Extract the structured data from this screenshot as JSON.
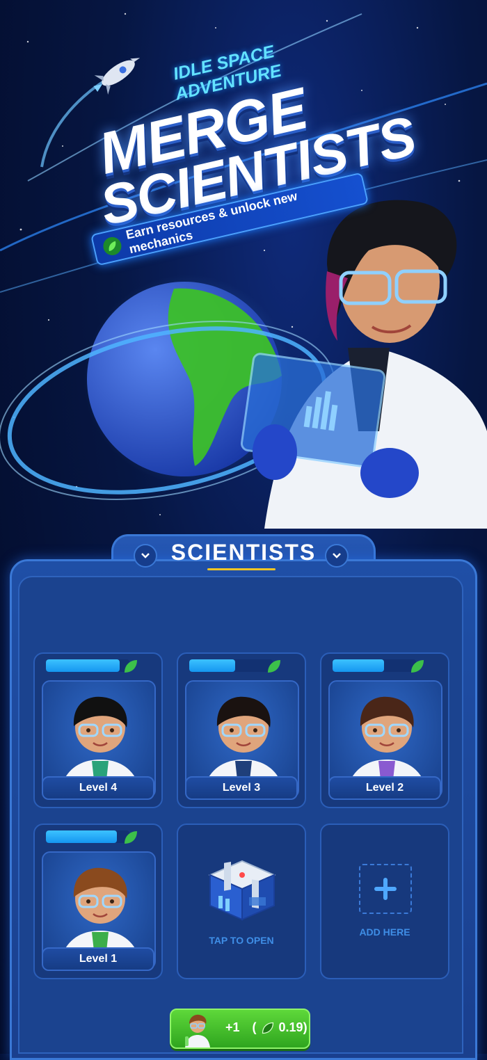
{
  "header": {
    "subtitle": "IDLE SPACE ADVENTURE",
    "title_line1": "MERGE",
    "title_line2": "SCIENTISTS",
    "tagline": "Earn resources & unlock new mechanics"
  },
  "panel": {
    "title": "SCIENTISTS",
    "slots": [
      {
        "type": "scientist",
        "level_label": "Level 4",
        "progress": 0.88,
        "hair": "#111111",
        "shirt": "#2aa37a"
      },
      {
        "type": "scientist",
        "level_label": "Level 3",
        "progress": 0.55,
        "hair": "#1a1210",
        "shirt": "#1f3f7a"
      },
      {
        "type": "scientist",
        "level_label": "Level 2",
        "progress": 0.62,
        "hair": "#4a2618",
        "shirt": "#8a5ad0"
      },
      {
        "type": "scientist",
        "level_label": "Level 1",
        "progress": 0.85,
        "hair": "#8a4a1e",
        "shirt": "#3cae4a"
      },
      {
        "type": "chest",
        "caption": "TAP TO OPEN"
      },
      {
        "type": "empty",
        "caption": "ADD HERE"
      }
    ]
  },
  "buy_button": {
    "amount": "+1",
    "open_paren": "(",
    "cost": "0.19)"
  },
  "colors": {
    "accent": "#3a78d6",
    "progress": "#1596f0",
    "leaf": "#3cc04a",
    "buy": "#2fa51f",
    "underline": "#f3c623"
  },
  "icons": [
    "rocket-icon",
    "leaf-icon",
    "chevron-down-icon",
    "plus-icon",
    "chest-icon"
  ]
}
